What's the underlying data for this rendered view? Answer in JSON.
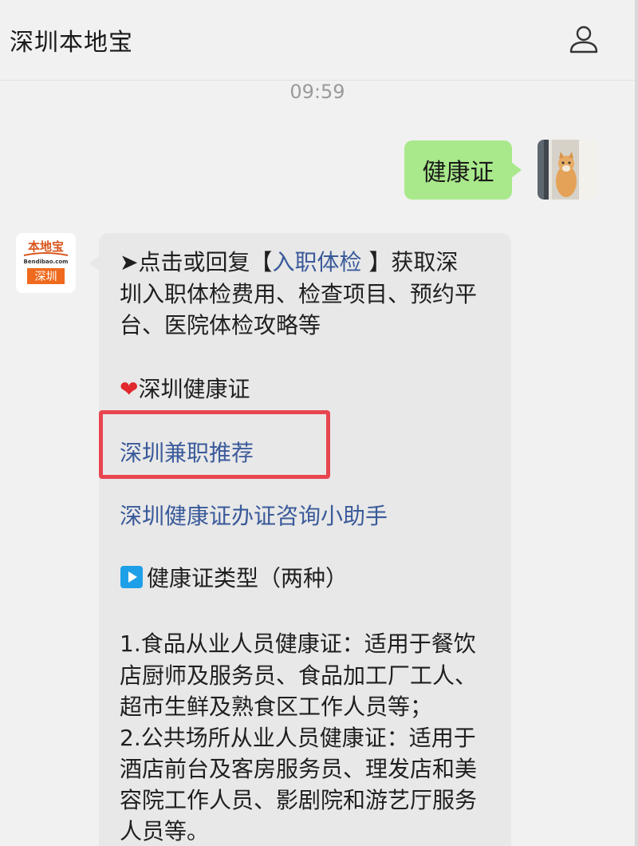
{
  "header": {
    "title": "深圳本地宝",
    "profile_icon": "user-profile-icon"
  },
  "chat": {
    "timestamp": "09:59",
    "outgoing": {
      "text": "健康证",
      "avatar": "user-avatar-cat-photo"
    },
    "incoming": {
      "avatar_brand": "本地宝",
      "avatar_domain": "Bendibao.com",
      "avatar_city": "深圳",
      "lines": {
        "l1_prefix": "➤点击或回复【",
        "l1_link": "入职体检",
        "l1_suffix": " 】获取深",
        "l2": "圳入职体检费用、检查项目、预约平",
        "l3": "台、医院体检攻略等",
        "l4_heart": "❤",
        "l4_text": "深圳健康证",
        "link_parttime": "深圳兼职推荐",
        "link_assistant": "深圳健康证办证咨询小助手",
        "section_title": "健康证类型（两种）",
        "p1": "1.食品从业人员健康证：适用于餐饮",
        "p2": "店厨师及服务员、食品加工厂工人、",
        "p3": "超市生鲜及熟食区工作人员等；",
        "p4": "2.公共场所从业人员健康证：适用于",
        "p5": "酒店前台及客房服务员、理发店和美",
        "p6": "容院工作人员、影剧院和游艺厅服务",
        "p7": "人员等。"
      }
    }
  },
  "colors": {
    "outgoing_bubble": "#a9e98b",
    "incoming_bubble": "#e8e8e8",
    "link": "#3a5a9a",
    "highlight": "#e8454e",
    "heart": "#e0282e"
  }
}
